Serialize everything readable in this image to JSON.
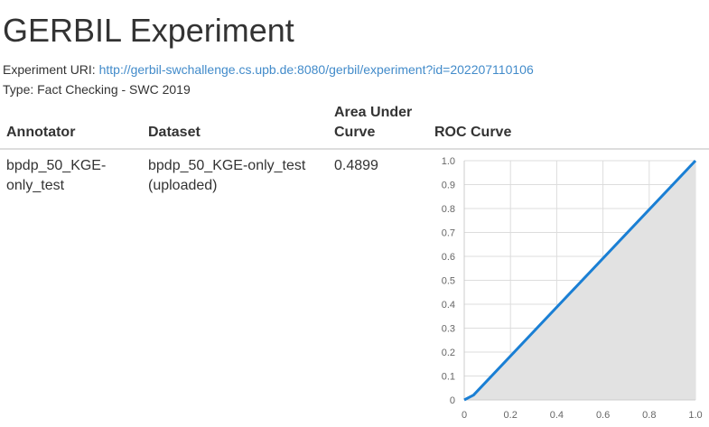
{
  "page": {
    "title": "GERBIL Experiment",
    "uri_label": "Experiment URI:",
    "uri": "http://gerbil-swchallenge.cs.upb.de:8080/gerbil/experiment?id=202207110106",
    "type_line": "Type: Fact Checking - SWC 2019"
  },
  "table": {
    "headers": {
      "annotator": "Annotator",
      "dataset": "Dataset",
      "auc_line1": "Area Under",
      "auc_line2": "Curve",
      "roc": "ROC Curve"
    },
    "row": {
      "annotator_line1": "bpdp_50_KGE-",
      "annotator_line2": "only_test",
      "dataset_line1": "bpdp_50_KGE-only_test",
      "dataset_line2": "(uploaded)",
      "auc": "0.4899"
    }
  },
  "chart_data": {
    "type": "area",
    "title": "",
    "xlabel": "",
    "ylabel": "",
    "xlim": [
      0,
      1
    ],
    "ylim": [
      0,
      1
    ],
    "grid": true,
    "x_ticks": [
      "0",
      "0.2",
      "0.4",
      "0.6",
      "0.8",
      "1.0"
    ],
    "y_ticks": [
      "0",
      "0.1",
      "0.2",
      "0.3",
      "0.4",
      "0.5",
      "0.6",
      "0.7",
      "0.8",
      "0.9",
      "1.0"
    ],
    "series": [
      {
        "x": [
          0,
          0.02,
          0.04,
          1.0
        ],
        "y": [
          0,
          0.01,
          0.02,
          1.0
        ]
      }
    ],
    "colors": {
      "line": "#1a7fd4",
      "fill": "#e2e2e2",
      "grid": "#dddddd"
    }
  }
}
